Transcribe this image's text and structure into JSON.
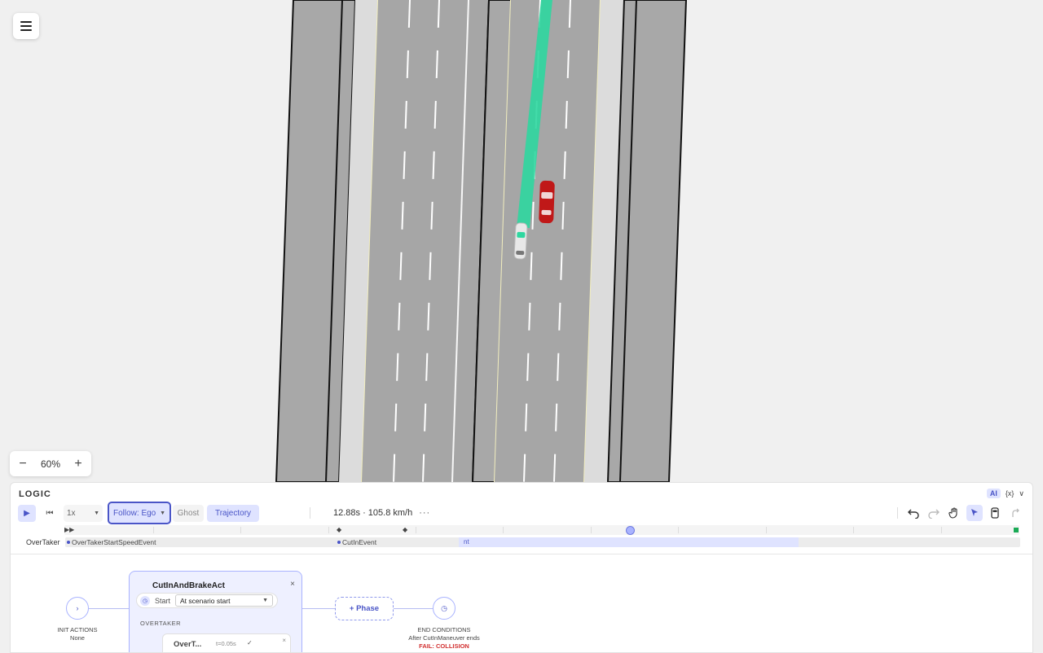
{
  "zoom": {
    "minus": "−",
    "value": "60%",
    "plus": "+"
  },
  "logic": {
    "title": "LOGIC",
    "ai_badge": "AI",
    "vars_badge": "{x}",
    "collapse": "∨"
  },
  "toolbar": {
    "play": "▶",
    "rewind": "⏮",
    "speed": "1x",
    "follow": "Follow: Ego",
    "ghost": "Ghost",
    "trajectory": "Trajectory",
    "status": "12.88s · 105.8 km/h",
    "more": "···"
  },
  "timeline": {
    "start_marker": "▶▶",
    "keyframe_a": "◆",
    "keyframe_b": "◆"
  },
  "track": {
    "label": "OverTaker",
    "events": [
      "OverTakerStartSpeedEvent",
      "CutInEvent"
    ],
    "highlight_text": "nt"
  },
  "flow": {
    "init_title": "INIT ACTIONS",
    "init_value": "None",
    "act_title": "CutInAndBrakeAct",
    "act_close": "×",
    "start_label": "Start",
    "start_value": "At scenario start",
    "actor_heading": "OVERTAKER",
    "maneuver_name": "OverT...",
    "maneuver_time": "t=0.05s",
    "maneuver_check": "✓",
    "maneuver_close": "×",
    "phase_button": "+ Phase",
    "end_title": "END CONDITIONS",
    "end_value": "After CutInManeuver ends",
    "end_fail": "FAIL: COLLISION"
  },
  "colors": {
    "accent": "#4a55c7",
    "accent_light": "#dfe3ff",
    "trajectory": "#2fd7a0",
    "ego_car": "#e8e8e8",
    "other_car": "#c01818",
    "fail": "#d23030"
  },
  "icons": [
    "menu-icon",
    "play-icon",
    "rewind-icon",
    "undo-icon",
    "redo-icon",
    "hand-icon",
    "pointer-icon",
    "car-icon",
    "route-icon",
    "start-clock-icon",
    "end-clock-icon"
  ]
}
